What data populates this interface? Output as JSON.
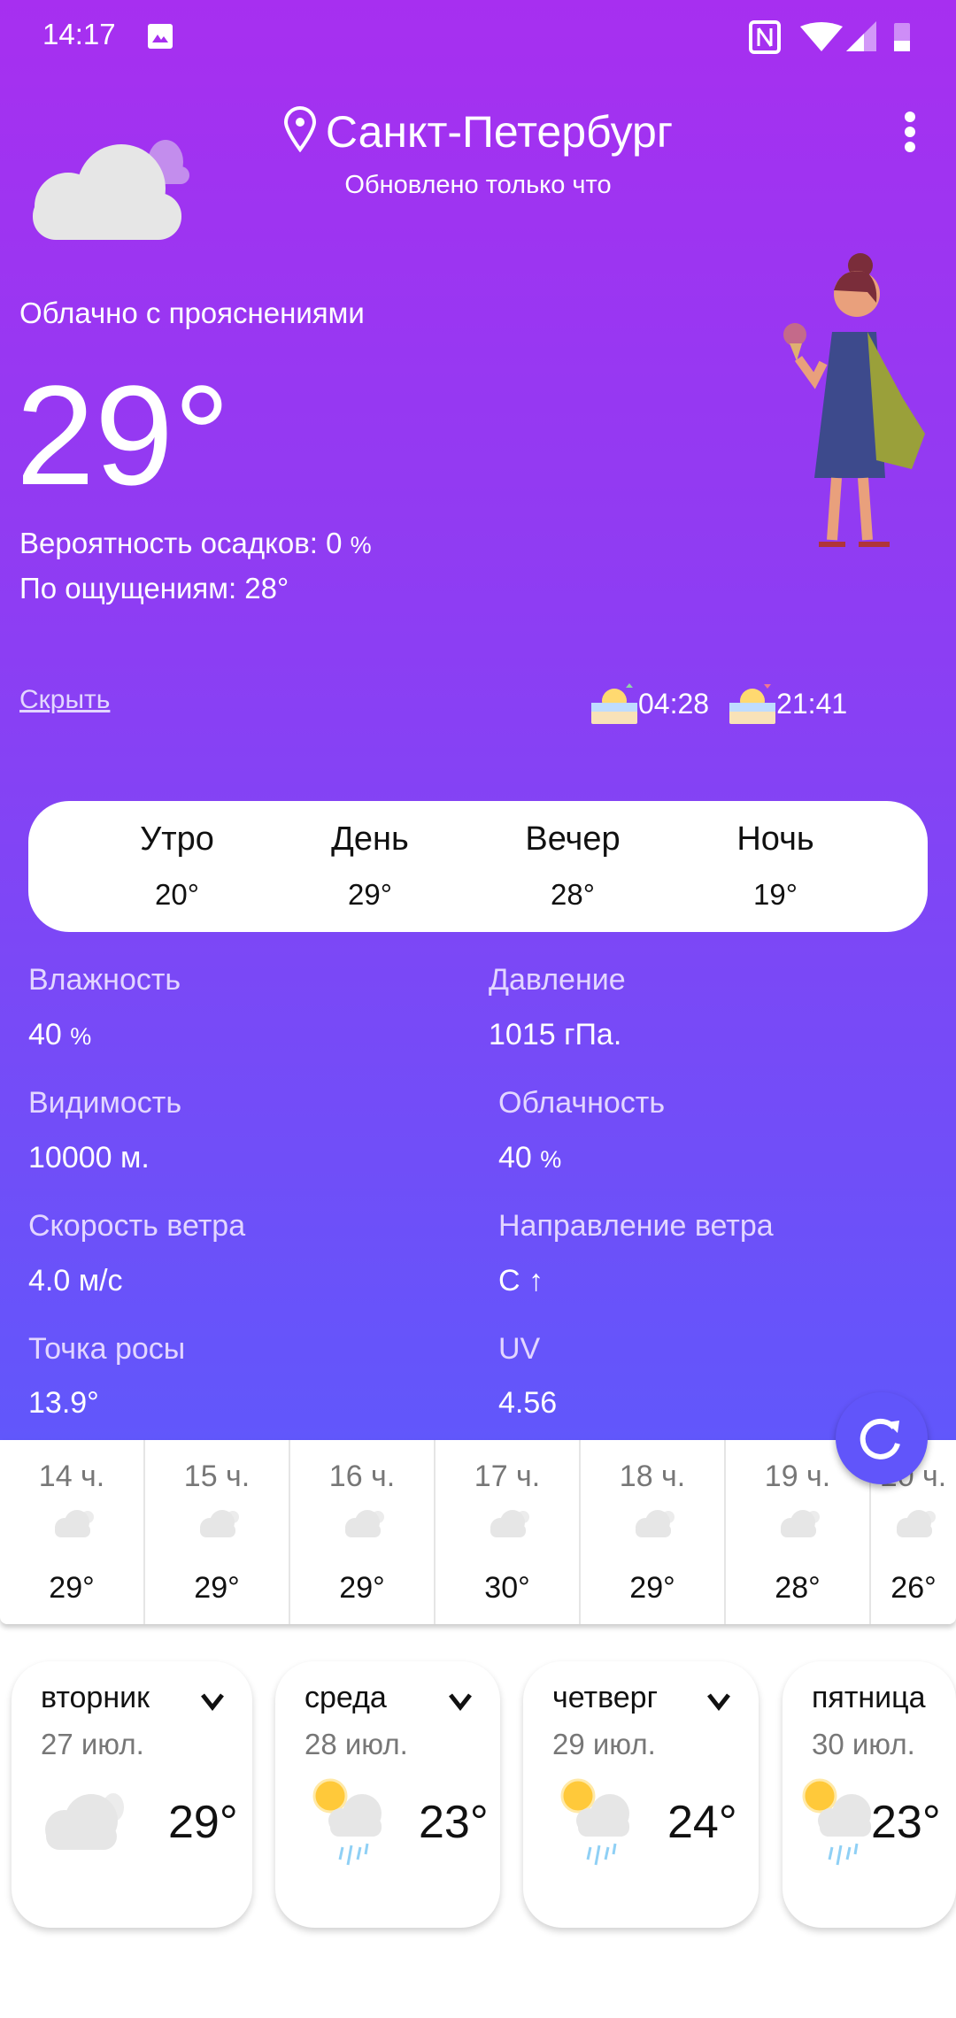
{
  "status_bar": {
    "time": "14:17"
  },
  "header": {
    "city": "Санкт-Петербург",
    "updated": "Обновлено только что"
  },
  "current": {
    "condition": "Облачно с прояснениями",
    "temperature": "29°",
    "precipitation": "Вероятность осадков: 0",
    "precipitation_unit": "%",
    "feels_like": "По ощущениям: 28°",
    "hide_link": "Скрыть",
    "sunrise": "04:28",
    "sunset": "21:41"
  },
  "day_parts": [
    {
      "label": "Утро",
      "temp": "20°"
    },
    {
      "label": "День",
      "temp": "29°"
    },
    {
      "label": "Вечер",
      "temp": "28°"
    },
    {
      "label": "Ночь",
      "temp": "19°"
    }
  ],
  "details": [
    {
      "label": "Влажность",
      "value": "40",
      "unit": "%"
    },
    {
      "label": "Давление",
      "value": "1015 гПа."
    },
    {
      "label": "Видимость",
      "value": "10000 м."
    },
    {
      "label": "Облачность",
      "value": "40",
      "unit": "%"
    },
    {
      "label": "Скорость ветра",
      "value": "4.0 м/с"
    },
    {
      "label": "Направление ветра",
      "value": "С ↑"
    },
    {
      "label": "Точка росы",
      "value": "13.9°"
    },
    {
      "label": "UV",
      "value": "4.56"
    }
  ],
  "hourly": [
    {
      "hour": "14 ч.",
      "temp": "29°"
    },
    {
      "hour": "15 ч.",
      "temp": "29°"
    },
    {
      "hour": "16 ч.",
      "temp": "29°"
    },
    {
      "hour": "17 ч.",
      "temp": "30°"
    },
    {
      "hour": "18 ч.",
      "temp": "29°"
    },
    {
      "hour": "19 ч.",
      "temp": "28°"
    },
    {
      "hour": "20 ч.",
      "temp": "26°"
    }
  ],
  "daily": [
    {
      "day": "вторник",
      "date": "27 июл.",
      "temp": "29°",
      "icon": "cloudy-icon"
    },
    {
      "day": "среда",
      "date": "28 июл.",
      "temp": "23°",
      "icon": "sun-rain-icon"
    },
    {
      "day": "четверг",
      "date": "29 июл.",
      "temp": "24°",
      "icon": "sun-rain-icon"
    },
    {
      "day": "пятница",
      "date": "30 июл.",
      "temp": "23°",
      "icon": "sun-rain-icon"
    }
  ],
  "colors": {
    "gradient_top": "#a72ff0",
    "gradient_bottom": "#6157fb",
    "fab": "#6155fa"
  }
}
